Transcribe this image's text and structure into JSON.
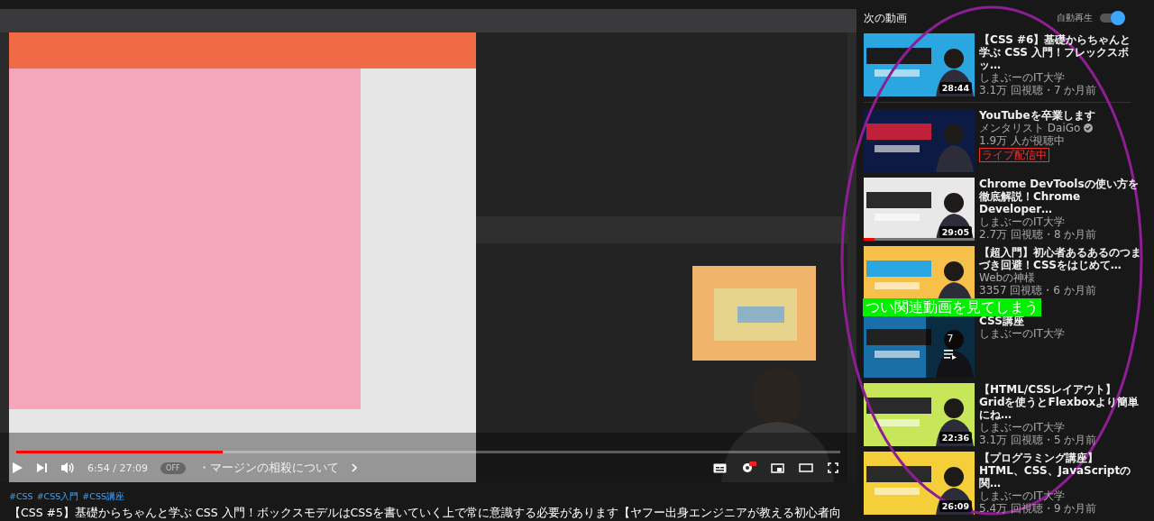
{
  "player": {
    "progress": {
      "level": 0.25
    },
    "time": "6:54 / 27:09",
    "autoplay": {
      "label": "OFF",
      "on": false
    },
    "chapter": "・マージンの相殺について"
  },
  "hashtags": [
    "#CSS",
    "#CSS入門",
    "#CSS講座"
  ],
  "title": "【CSS #5】基礎からちゃんと学ぶ CSS 入門！ボックスモデルはCSSを書いていく上で常に意識する必要があります【ヤフー出身エンジニアが教える初心者向",
  "sidebar": {
    "heading": "次の動画",
    "autoplay": {
      "label": "自動再生",
      "on": true
    },
    "items": [
      {
        "kind": "video",
        "title": "【CSS #6】基礎からちゃんと学ぶ CSS 入門！フレックスボッ…",
        "channel": "しまぶーのIT大学",
        "verified": false,
        "meta": "3.1万 回視聴・7 か月前",
        "duration": "28:44"
      },
      {
        "kind": "live",
        "title": "YouTubeを卒業します",
        "channel": "メンタリスト DaiGo",
        "verified": true,
        "meta": "1.9万 人が視聴中",
        "badge": "ライブ配信中"
      },
      {
        "kind": "video",
        "title": "Chrome DevToolsの使い方を徹底解説！Chrome Developer…",
        "channel": "しまぶーのIT大学",
        "verified": false,
        "meta": "2.7万 回視聴・8 か月前",
        "duration": "29:05",
        "level": 0.1
      },
      {
        "kind": "video",
        "title": "【超入門】初心者あるあるのつまづき回避！CSSをはじめて…",
        "channel": "Webの神様",
        "verified": false,
        "meta": "3357 回視聴・6 か月前"
      },
      {
        "kind": "playlist",
        "title": "CSS講座",
        "channel": "しまぶーのIT大学",
        "verified": false,
        "count": "7"
      },
      {
        "kind": "video",
        "title": "【HTML/CSSレイアウト】Gridを使うとFlexboxより簡単にね…",
        "channel": "しまぶーのIT大学",
        "verified": false,
        "meta": "3.1万 回視聴・5 か月前",
        "duration": "22:36"
      },
      {
        "kind": "video",
        "title": "【プログラミング講座】HTML、CSS、JavaScriptの関…",
        "channel": "しまぶーのIT大学",
        "verified": false,
        "meta": "5.4万 回視聴・9 か月前",
        "duration": "26:09"
      }
    ]
  },
  "annotation": {
    "caption": "つい関連動画を見てしまう"
  }
}
